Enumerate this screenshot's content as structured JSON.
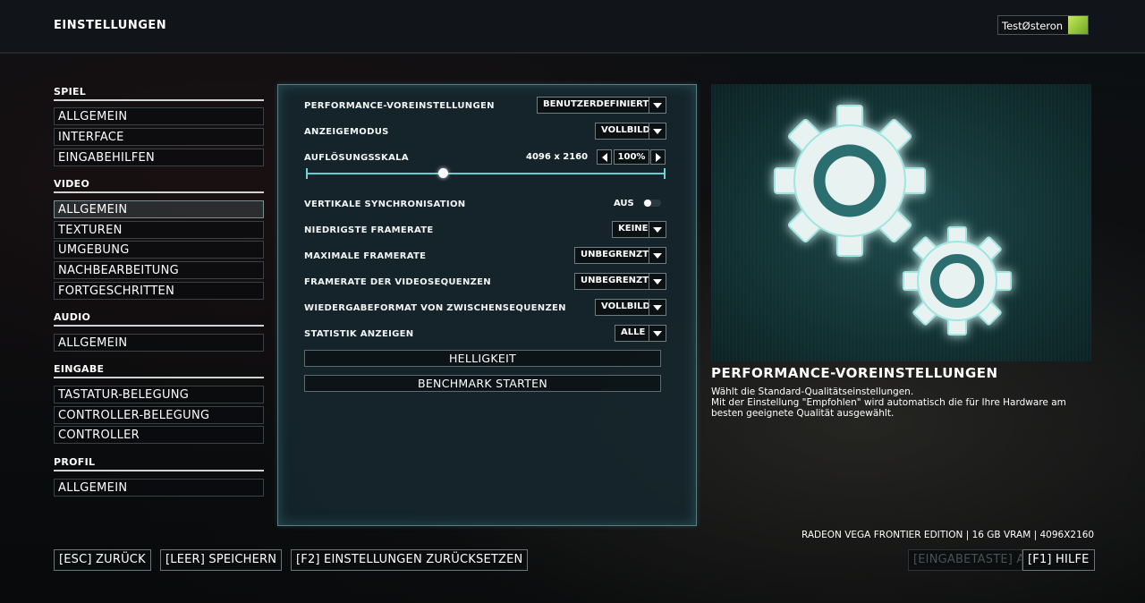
{
  "header": {
    "title": "EINSTELLUNGEN",
    "gamertag": "TestØsteron"
  },
  "sidebar": {
    "categories": [
      {
        "label": "SPIEL",
        "items": [
          "ALLGEMEIN",
          "INTERFACE",
          "EINGABEHILFEN"
        ]
      },
      {
        "label": "VIDEO",
        "items": [
          "ALLGEMEIN",
          "TEXTUREN",
          "UMGEBUNG",
          "NACHBEARBEITUNG",
          "FORTGESCHRITTEN"
        ]
      },
      {
        "label": "AUDIO",
        "items": [
          "ALLGEMEIN"
        ]
      },
      {
        "label": "EINGABE",
        "items": [
          "TASTATUR-BELEGUNG",
          "CONTROLLER-BELEGUNG",
          "CONTROLLER"
        ]
      },
      {
        "label": "PROFIL",
        "items": [
          "ALLGEMEIN"
        ]
      }
    ],
    "active": "VIDEO / ALLGEMEIN"
  },
  "settings": {
    "preset": {
      "label": "PERFORMANCE-VOREINSTELLUNGEN",
      "value": "BENUTZERDEFINIERT"
    },
    "display_mode": {
      "label": "ANZEIGEMODUS",
      "value": "VOLLBILD"
    },
    "resolution_scale": {
      "label": "AUFLÖSUNGSSKALA",
      "resolution": "4096 x 2160",
      "value": "100%",
      "slider_level": 0.38
    },
    "vsync": {
      "label": "VERTIKALE SYNCHRONISATION",
      "value": "AUS"
    },
    "min_framerate": {
      "label": "NIEDRIGSTE FRAMERATE",
      "value": "KEINE"
    },
    "max_framerate": {
      "label": "MAXIMALE FRAMERATE",
      "value": "UNBEGRENZT"
    },
    "cutscene_framerate": {
      "label": "FRAMERATE DER VIDEOSEQUENZEN",
      "value": "UNBEGRENZT"
    },
    "cutscene_format": {
      "label": "WIEDERGABEFORMAT VON ZWISCHENSEQUENZEN",
      "value": "VOLLBILD"
    },
    "stats": {
      "label": "STATISTIK ANZEIGEN",
      "value": "ALLE"
    },
    "brightness_button": "HELLIGKEIT",
    "benchmark_button": "BENCHMARK STARTEN"
  },
  "description": {
    "title": "PERFORMANCE-VOREINSTELLUNGEN",
    "line1": "Wählt die Standard-Qualitätseinstellungen.",
    "line2": "Mit der Einstellung \"Empfohlen\" wird automatisch die für Ihre Hardware am",
    "line3": "besten geeignete Qualität ausgewählt."
  },
  "hardware_info": "RADEON VEGA FRONTIER EDITION | 16 GB VRAM | 4096X2160",
  "footer": {
    "back": "[ESC] ZURÜCK",
    "save": "[LEER] SPEICHERN",
    "reset": "[F2] EINSTELLUNGEN ZURÜCKSETZEN",
    "apply": "[EINGABETASTE] A",
    "help": "[F1] HILFE"
  },
  "icons": {
    "preview": "gears-icon",
    "avatar": "avatar"
  },
  "colors": {
    "accent": "#5fd0cf",
    "panel": "#16262c",
    "gamerpic": "#8cc63f"
  }
}
